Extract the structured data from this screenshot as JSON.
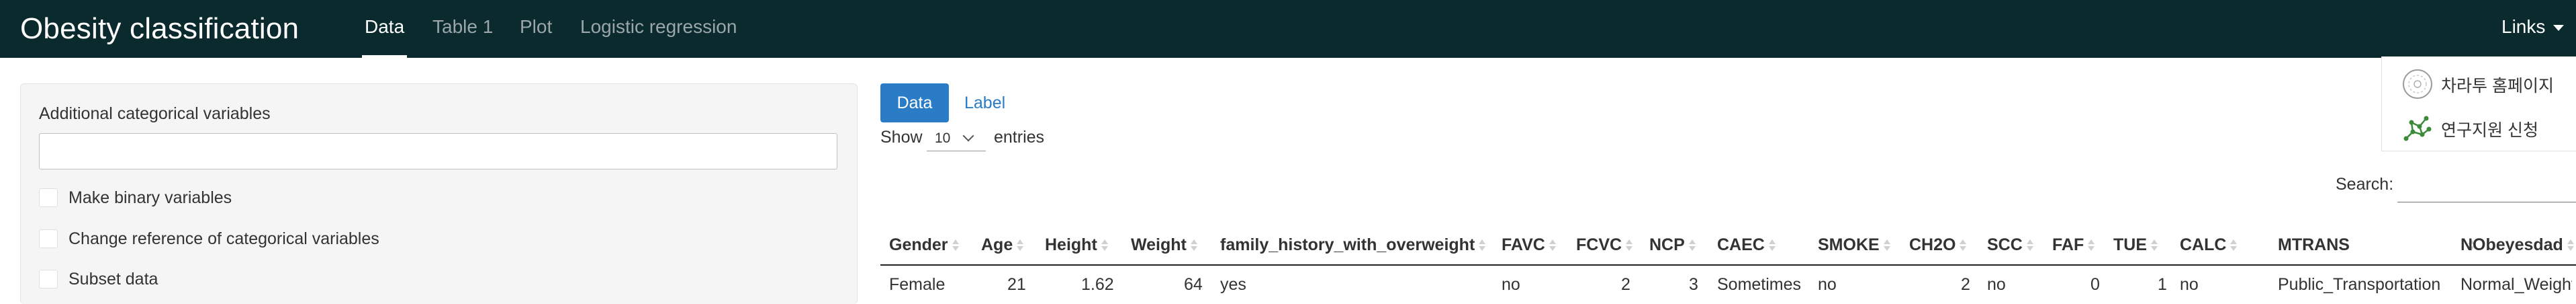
{
  "navbar": {
    "brand": "Obesity classification",
    "tabs": [
      {
        "label": "Data",
        "active": true
      },
      {
        "label": "Table 1",
        "active": false
      },
      {
        "label": "Plot",
        "active": false
      },
      {
        "label": "Logistic regression",
        "active": false
      }
    ],
    "links_label": "Links",
    "bg_color": "#0a2a2e"
  },
  "dropdown": {
    "items": [
      {
        "label": "차라투 홈페이지",
        "icon": "globe-icon"
      },
      {
        "label": "연구지원 신청",
        "icon": "research-network-icon"
      }
    ]
  },
  "sidebar": {
    "input_label": "Additional categorical variables",
    "input_value": "",
    "checkboxes": [
      {
        "label": "Make binary variables",
        "checked": false
      },
      {
        "label": "Change reference of categorical variables",
        "checked": false
      },
      {
        "label": "Subset data",
        "checked": false
      }
    ]
  },
  "main": {
    "data_button": "Data",
    "label_button": "Label",
    "show_prefix": "Show",
    "page_length": "10",
    "show_suffix": "entries",
    "search_label": "Search:",
    "search_value": "",
    "accent_color": "#2a7cc7"
  },
  "table": {
    "columns": [
      "Gender",
      "Age",
      "Height",
      "Weight",
      "family_history_with_overweight",
      "FAVC",
      "FCVC",
      "NCP",
      "CAEC",
      "SMOKE",
      "CH2O",
      "SCC",
      "FAF",
      "TUE",
      "CALC",
      "MTRANS",
      "NObeyesdad"
    ],
    "rows": [
      [
        "Female",
        "21",
        "1.62",
        "64",
        "yes",
        "no",
        "2",
        "3",
        "Sometimes",
        "no",
        "2",
        "no",
        "0",
        "1",
        "no",
        "Public_Transportation",
        "Normal_Weight"
      ]
    ]
  }
}
